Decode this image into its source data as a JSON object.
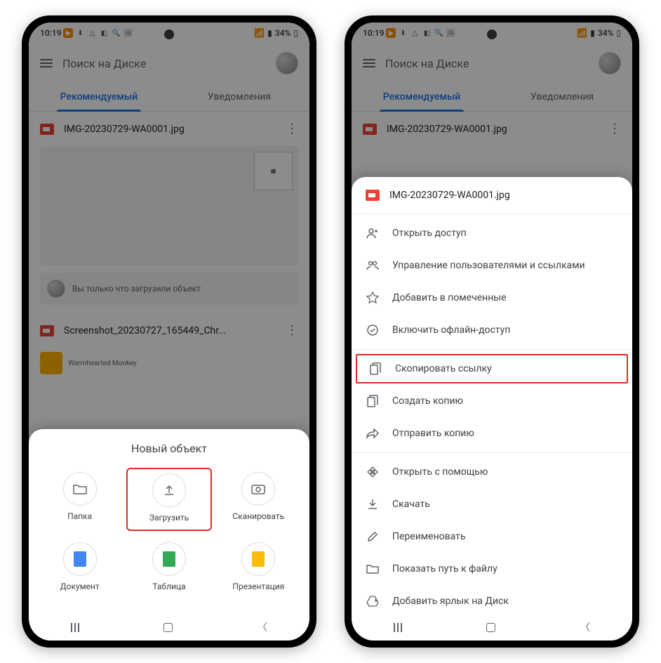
{
  "status": {
    "time": "10:19",
    "battery": "34%"
  },
  "search": {
    "placeholder": "Поиск на Диске"
  },
  "tabs": {
    "recommended": "Рекомендуемый",
    "notifications": "Уведомления"
  },
  "files": {
    "f1": "IMG-20230729-WA0001.jpg",
    "f2": "Screenshot_20230727_165449_Chr...",
    "monkey": "Warmhearted Monkey"
  },
  "info": {
    "uploaded": "Вы только что загрузили объект"
  },
  "sheet1": {
    "title": "Новый объект",
    "folder": "Папка",
    "upload": "Загрузить",
    "scan": "Сканировать",
    "doc": "Документ",
    "sheet": "Таблица",
    "pres": "Презентация"
  },
  "sheet2": {
    "title": "IMG-20230729-WA0001.jpg",
    "share": "Открыть доступ",
    "manage": "Управление пользователями и ссылками",
    "star": "Добавить в помеченные",
    "offline": "Включить офлайн-доступ",
    "copylink": "Скопировать ссылку",
    "makecopy": "Создать копию",
    "sendcopy": "Отправить копию",
    "openwith": "Открыть с помощью",
    "download": "Скачать",
    "rename": "Переименовать",
    "showpath": "Показать путь к файлу",
    "shortcut": "Добавить ярлык на Диск"
  }
}
